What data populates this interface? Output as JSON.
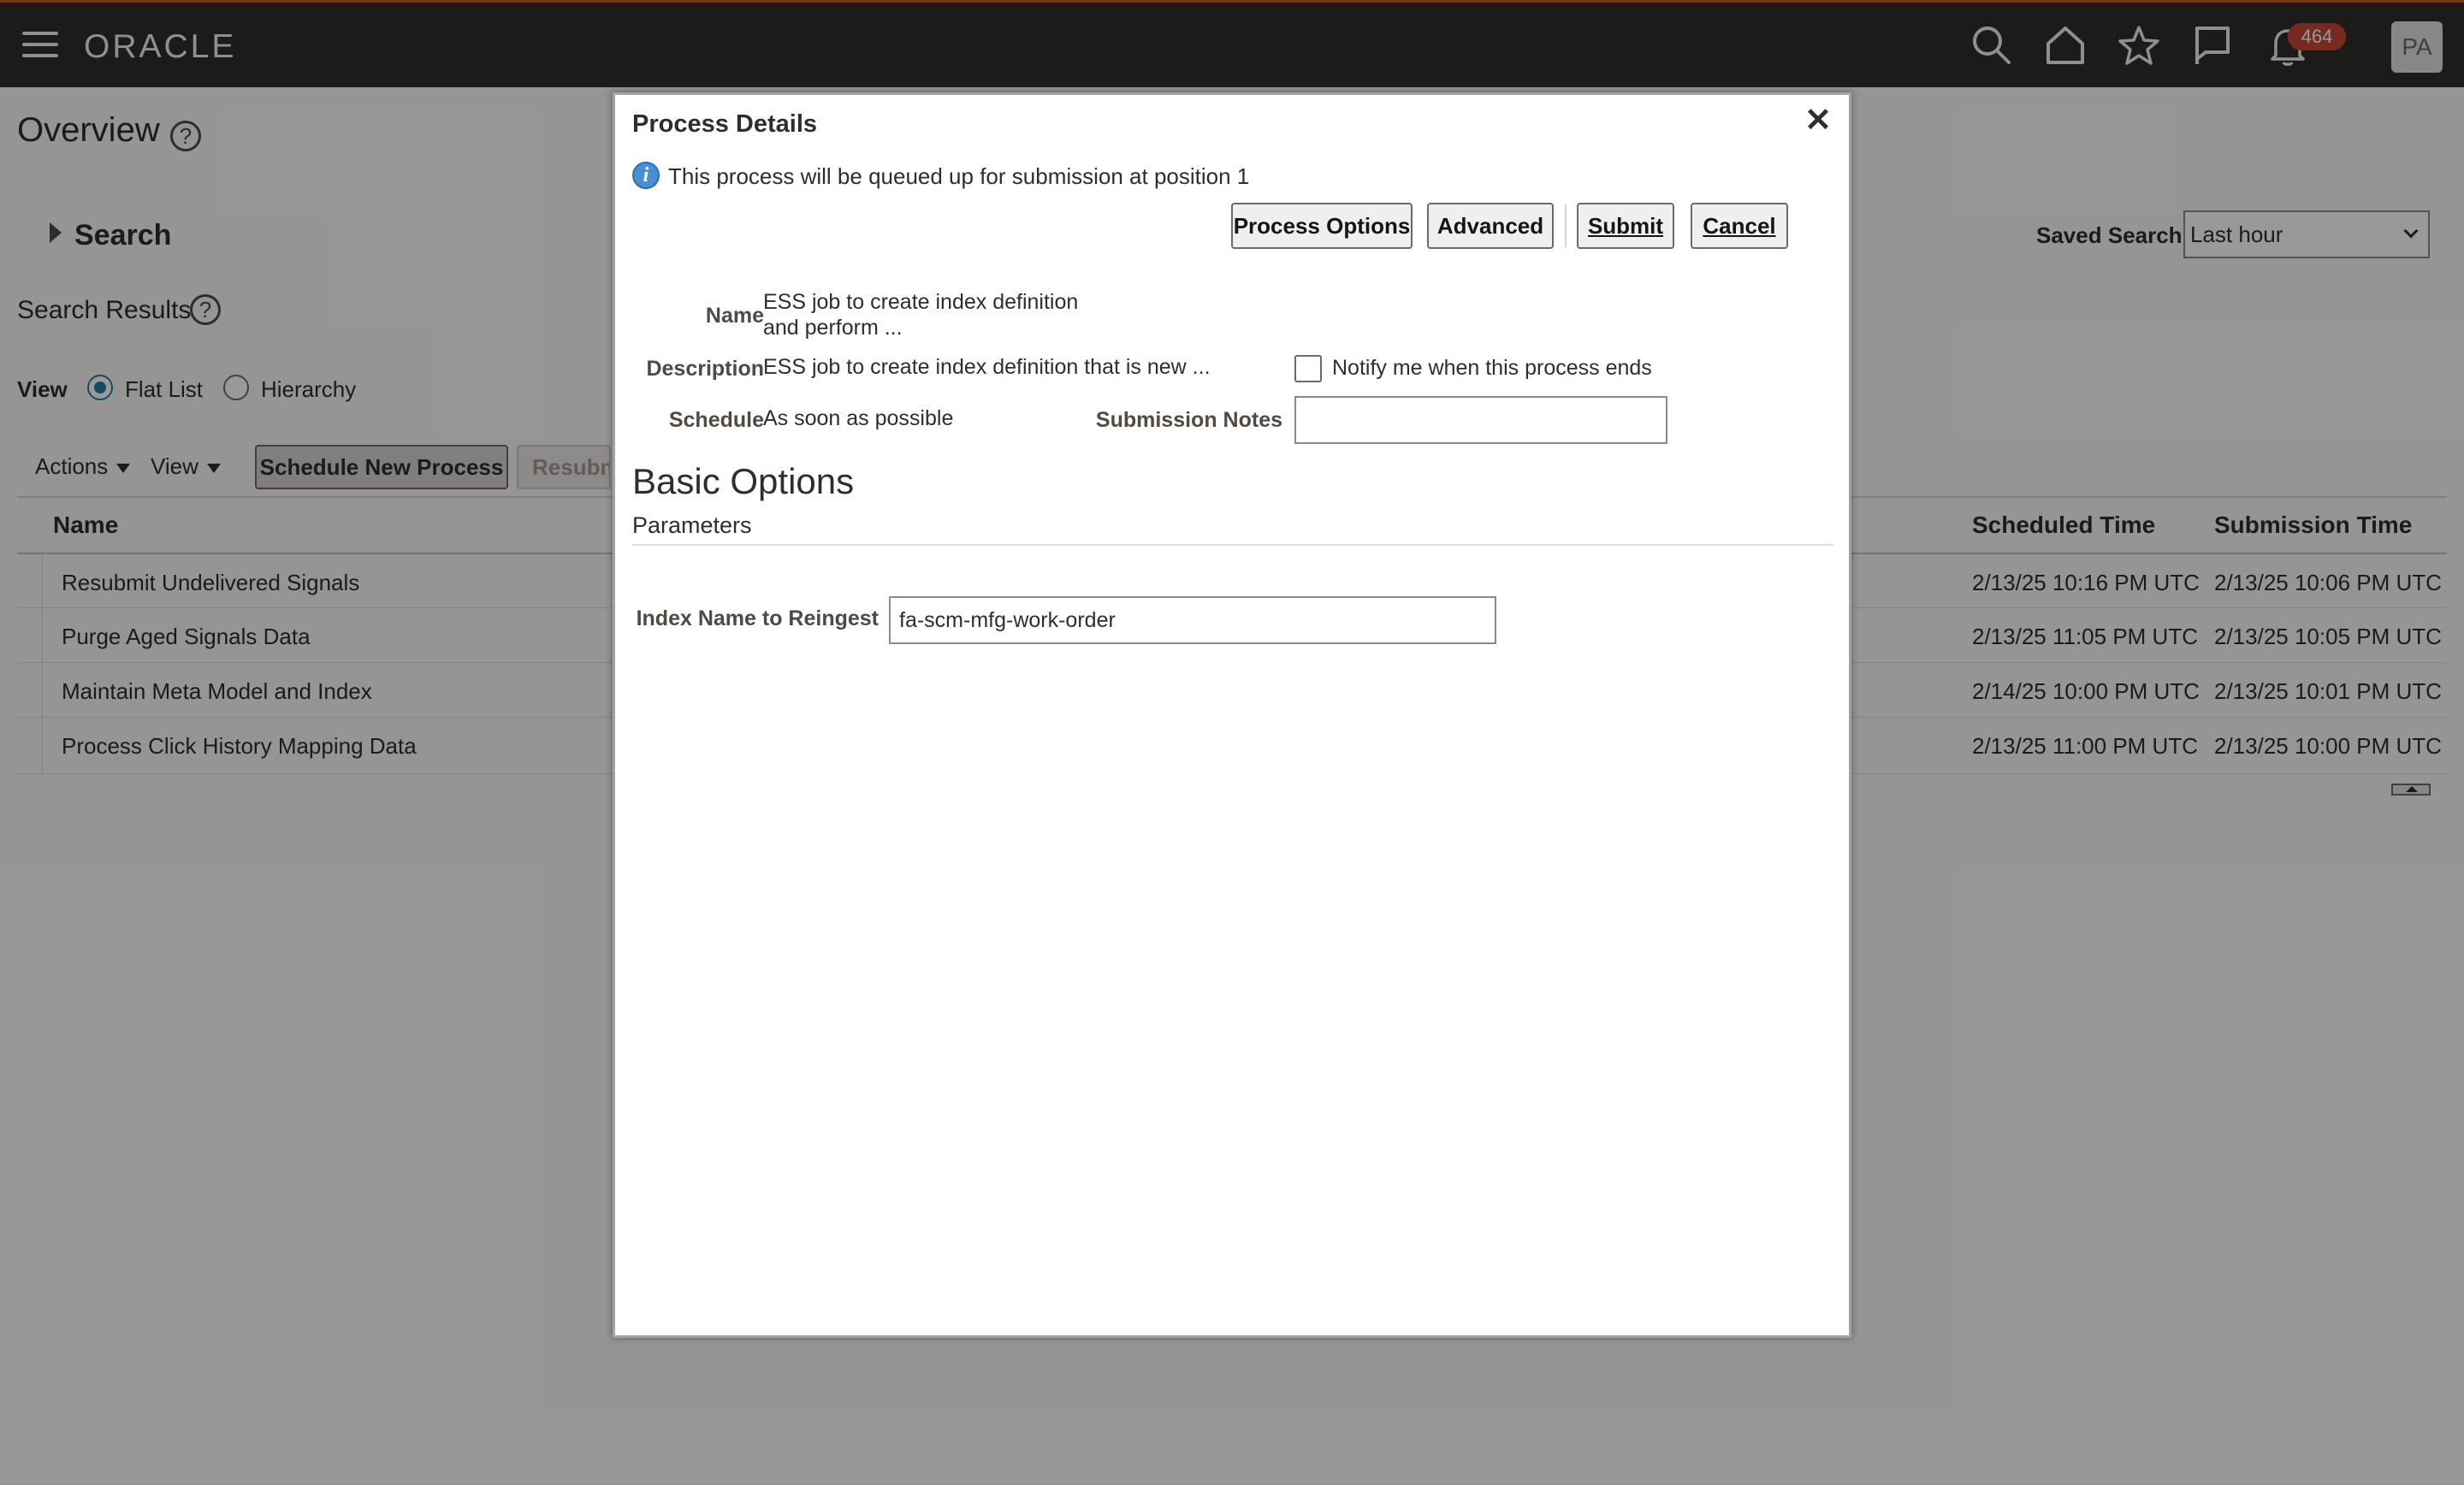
{
  "header": {
    "logo": "ORACLE",
    "notification_count": "464",
    "avatar_initials": "PA"
  },
  "page": {
    "title": "Overview",
    "search_label": "Search",
    "search_results_label": "Search Results",
    "view_label": "View",
    "view_options": [
      "Flat List",
      "Hierarchy"
    ],
    "actions_menu": "Actions",
    "view_menu": "View",
    "schedule_button": "Schedule New Process",
    "resubmit_button": "Resubmit",
    "saved_search_label": "Saved Search",
    "saved_search_value": "Last hour",
    "columns": [
      "Name",
      "Scheduled Time",
      "Submission Time"
    ],
    "rows": [
      {
        "name": "Resubmit Undelivered Signals",
        "scheduled": "2/13/25 10:16 PM UTC",
        "submitted": "2/13/25 10:06 PM UTC"
      },
      {
        "name": "Purge Aged Signals Data",
        "scheduled": "2/13/25 11:05 PM UTC",
        "submitted": "2/13/25 10:05 PM UTC"
      },
      {
        "name": "Maintain Meta Model and Index",
        "scheduled": "2/14/25 10:00 PM UTC",
        "submitted": "2/13/25 10:01 PM UTC"
      },
      {
        "name": "Process Click History Mapping Data",
        "scheduled": "2/13/25 11:00 PM UTC",
        "submitted": "2/13/25 10:00 PM UTC"
      }
    ]
  },
  "dialog": {
    "title": "Process Details",
    "info_message": "This process will be queued up for submission at position 1",
    "buttons": {
      "process_options": "Process Options",
      "advanced": "Advanced",
      "submit": "Submit",
      "cancel": "Cancel"
    },
    "fields": {
      "name_label": "Name",
      "name_value_line1": "ESS job to create index definition",
      "name_value_line2": "and perform ...",
      "description_label": "Description",
      "description_value": "ESS job to create index definition that is new ...",
      "schedule_label": "Schedule",
      "schedule_value": "As soon as possible",
      "notify_label": "Notify me when this process ends",
      "submission_notes_label": "Submission Notes",
      "submission_notes_value": ""
    },
    "basic_options_title": "Basic Options",
    "parameters_label": "Parameters",
    "index_label": "Index Name to Reingest",
    "index_value": "fa-scm-mfg-work-order"
  },
  "colors": {
    "header_bg": "#312d2a",
    "accent_blue": "#227e9e",
    "badge_red": "#c74634"
  },
  "icons": [
    "hamburger-icon",
    "search-icon",
    "home-icon",
    "star-icon",
    "flag-icon",
    "bell-icon",
    "help-icon",
    "info-icon",
    "close-icon"
  ]
}
